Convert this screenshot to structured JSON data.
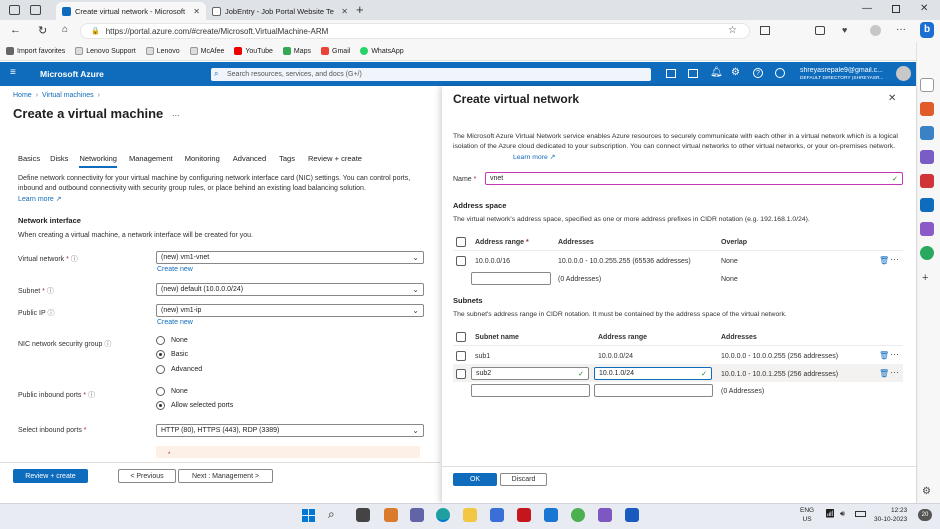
{
  "browser": {
    "tabs": [
      {
        "title": "Create virtual network - Microsoft"
      },
      {
        "title": "JobEntry - Job Portal Website Te"
      }
    ],
    "url": "https://portal.azure.com/#create/Microsoft.VirtualMachine-ARM",
    "bookmarks": [
      "Import favorites",
      "Lenovo Support",
      "Lenovo",
      "McAfee",
      "YouTube",
      "Maps",
      "Gmail",
      "WhatsApp"
    ]
  },
  "azure": {
    "brand": "Microsoft Azure",
    "search_placeholder": "Search resources, services, and docs (G+/)",
    "user_email": "shreyasrepale9@gmail.c...",
    "user_dir": "DEFAULT DIRECTORY (SHREYASR..."
  },
  "left": {
    "breadcrumb": [
      "Home",
      "Virtual machines"
    ],
    "title": "Create a virtual machine",
    "more": "...",
    "tabs": [
      "Basics",
      "Disks",
      "Networking",
      "Management",
      "Monitoring",
      "Advanced",
      "Tags",
      "Review + create"
    ],
    "active_tab": "Networking",
    "intro": "Define network connectivity for your virtual machine by configuring network interface card (NIC) settings. You can control ports, inbound and outbound connectivity with security group rules, or place behind an existing load balancing solution.",
    "learn_more": "Learn more",
    "section_title": "Network interface",
    "section_desc": "When creating a virtual machine, a network interface will be created for you.",
    "fields": {
      "vnet_label": "Virtual network",
      "vnet_value": "(new) vm1-vnet",
      "vnet_create": "Create new",
      "subnet_label": "Subnet",
      "subnet_value": "(new) default (10.0.0.0/24)",
      "pip_label": "Public IP",
      "pip_value": "(new) vm1-ip",
      "pip_create": "Create new",
      "nsg_label": "NIC network security group",
      "nsg_options": [
        "None",
        "Basic",
        "Advanced"
      ],
      "nsg_selected": "Basic",
      "ports_label": "Public inbound ports",
      "ports_options": [
        "None",
        "Allow selected ports"
      ],
      "ports_selected": "Allow selected ports",
      "inbound_label": "Select inbound ports",
      "inbound_value": "HTTP (80), HTTPS (443), RDP (3389)"
    },
    "footer": {
      "review": "Review + create",
      "prev": "< Previous",
      "next": "Next : Management >"
    }
  },
  "panel": {
    "title": "Create virtual network",
    "description": "The Microsoft Azure Virtual Network service enables Azure resources to securely communicate with each other in a virtual network which is a logical isolation of the Azure cloud dedicated to your subscription. You can connect virtual networks to other virtual networks, or your on-premises network.",
    "learn_more": "Learn more",
    "name_label": "Name",
    "name_value": "vnet",
    "address_space_title": "Address space",
    "address_space_desc": "The virtual network's address space, specified as one or more address prefixes in CIDR notation (e.g. 192.168.1.0/24).",
    "as_headers": [
      "Address range",
      "Addresses",
      "Overlap"
    ],
    "as_rows": [
      {
        "range": "10.0.0.0/16",
        "addresses": "10.0.0.0 - 10.0.255.255 (65536 addresses)",
        "overlap": "None"
      },
      {
        "range": "",
        "addresses": "(0 Addresses)",
        "overlap": "None"
      }
    ],
    "subnets_title": "Subnets",
    "subnets_desc": "The subnet's address range in CIDR notation. It must be contained by the address space of the virtual network.",
    "sn_headers": [
      "Subnet name",
      "Address range",
      "Addresses"
    ],
    "sn_rows": [
      {
        "name": "sub1",
        "range": "10.0.0.0/24",
        "addresses": "10.0.0.0 - 10.0.0.255 (256 addresses)"
      },
      {
        "name": "sub2",
        "range": "10.0.1.0/24",
        "addresses": "10.0.1.0 - 10.0.1.255 (256 addresses)"
      },
      {
        "name": "",
        "range": "",
        "addresses": "(0 Addresses)"
      }
    ],
    "ok": "OK",
    "discard": "Discard"
  },
  "taskbar": {
    "lang": "ENG",
    "region": "US",
    "time": "12:23",
    "date": "30-10-2023",
    "badge": "20"
  }
}
